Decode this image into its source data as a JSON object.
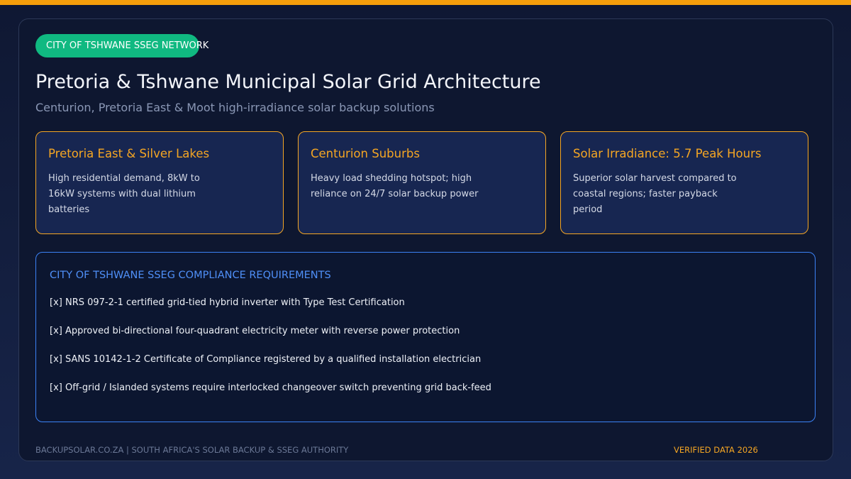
{
  "header": {
    "tag": "CITY OF TSHWANE SSEG NETWORK",
    "title": "Pretoria & Tshwane Municipal Solar Grid Architecture",
    "subtitle": "Centurion, Pretoria East & Moot high-irradiance solar backup solutions"
  },
  "cards": [
    {
      "title": "Pretoria East & Silver Lakes",
      "text": "High residential demand, 8kW to 16kW systems with dual lithium batteries"
    },
    {
      "title": "Centurion Suburbs",
      "text": "Heavy load shedding hotspot; high reliance on 24/7 solar backup power"
    },
    {
      "title": "Solar Irradiance: 5.7 Peak Hours",
      "text": "Superior solar harvest compared to coastal regions; faster payback period"
    }
  ],
  "requirements": {
    "title": "CITY OF TSHWANE SSEG COMPLIANCE REQUIREMENTS",
    "items": [
      "[x] NRS 097-2-1 certified grid-tied hybrid inverter with Type Test Certification",
      "[x] Approved bi-directional four-quadrant electricity meter with reverse power protection",
      "[x] SANS 10142-1-2 Certificate of Compliance registered by a qualified installation electrician",
      "[x] Off-grid / Islanded systems require interlocked changeover switch preventing grid back-feed"
    ]
  },
  "footer": {
    "left": "BACKUPSOLAR.CO.ZA | SOUTH AFRICA'S SOLAR BACKUP & SSEG AUTHORITY",
    "right": "VERIFIED DATA 2026"
  },
  "colors": {
    "accent_orange": "#f59e0b",
    "tag_green": "#10b981",
    "card_border": "#f5a623",
    "requirements_blue": "#3b82f6"
  }
}
